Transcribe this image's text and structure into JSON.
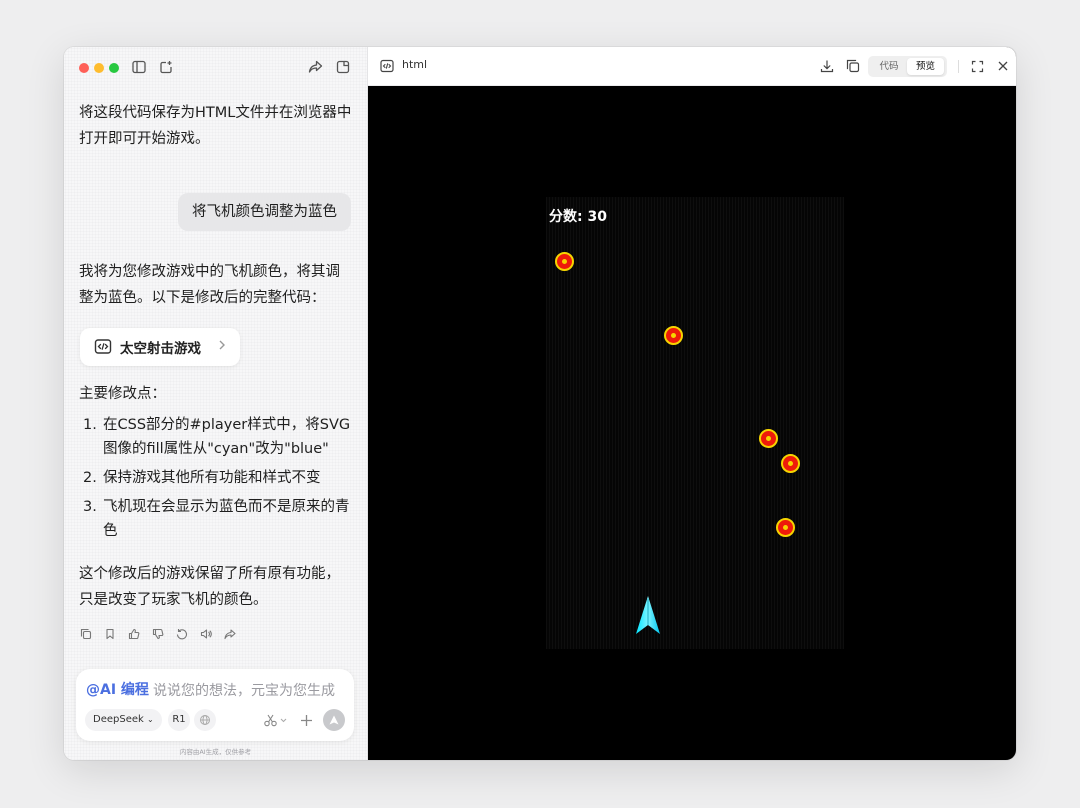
{
  "chat": {
    "messages": {
      "intro": "将这段代码保存为HTML文件并在浏览器中打开即可开始游戏。",
      "user_request": "将飞机颜色调整为蓝色",
      "reply": "我将为您修改游戏中的飞机颜色，将其调整为蓝色。以下是修改后的完整代码：",
      "file_card_label": "太空射击游戏",
      "changes_heading": "主要修改点：",
      "changes": [
        {
          "num": "1.",
          "text": "在CSS部分的#player样式中，将SVG图像的fill属性从\"cyan\"改为\"blue\""
        },
        {
          "num": "2.",
          "text": "保持游戏其他所有功能和样式不变"
        },
        {
          "num": "3.",
          "text": "飞机现在会显示为蓝色而不是原来的青色"
        }
      ],
      "summary": "这个修改后的游戏保留了所有原有功能，只是改变了玩家飞机的颜色。"
    },
    "composer": {
      "ai_tag": "@AI 编程",
      "placeholder": "说说您的想法，元宝为您生成",
      "model": "DeepSeek",
      "mode": "R1"
    },
    "disclaimer": "内容由AI生成，仅供参考"
  },
  "preview": {
    "title": "html",
    "tabs": {
      "code": "代码",
      "preview": "预览"
    },
    "active_tab": "preview"
  },
  "game": {
    "score_label": "分数: 30",
    "enemy_count": 5,
    "enemy_color": "#ee1a0a",
    "enemy_ring_color": "#f6d400",
    "player_color": "cyan",
    "background_color": "#000000"
  },
  "icons": [
    "sidebar-icon",
    "new-chat-icon",
    "share-icon",
    "window-icon",
    "code-file-icon",
    "chevron-right-icon",
    "copy-icon",
    "bookmark-icon",
    "thumbs-up-icon",
    "thumbs-down-icon",
    "refresh-icon",
    "speaker-icon",
    "forward-icon",
    "globe-icon",
    "scissors-icon",
    "plus-icon",
    "send-icon",
    "download-icon",
    "expand-icon",
    "close-icon"
  ]
}
